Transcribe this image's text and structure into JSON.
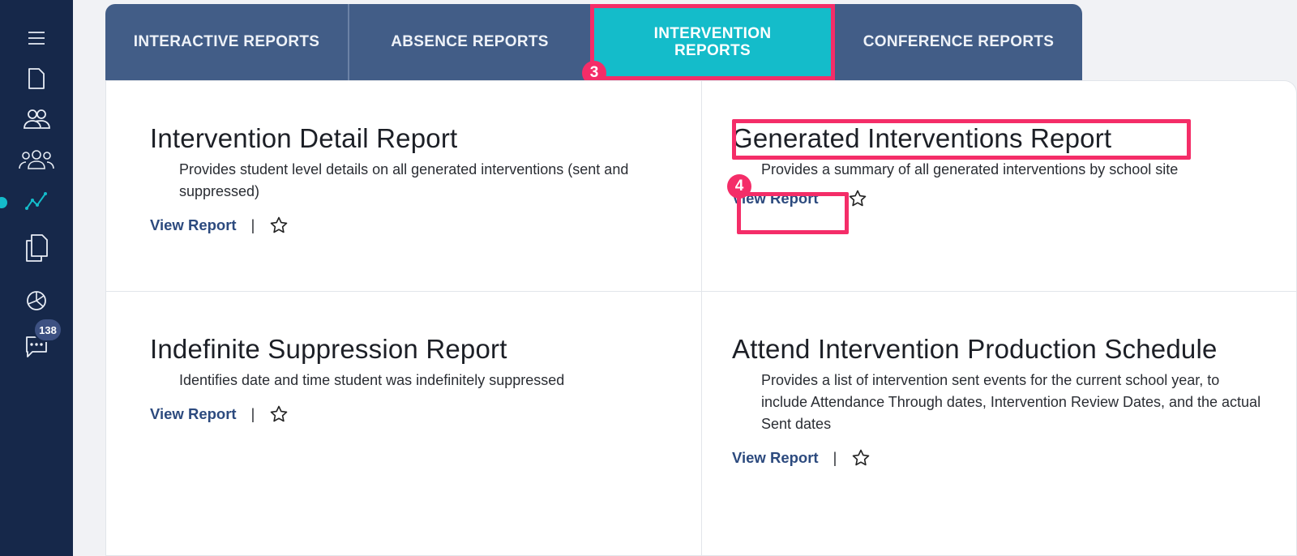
{
  "sidebar": {
    "icons": [
      "menu-icon",
      "document-icon",
      "users-icon",
      "group-icon",
      "analytics-icon",
      "copy-icon",
      "pie-chart-icon",
      "chat-icon"
    ],
    "chat_badge": "138"
  },
  "tabs": [
    {
      "label": "INTERACTIVE REPORTS"
    },
    {
      "label": "ABSENCE REPORTS"
    },
    {
      "label": "INTERVENTION REPORTS"
    },
    {
      "label": "CONFERENCE REPORTS"
    }
  ],
  "cards": [
    {
      "title": "Intervention Detail Report",
      "description": "Provides student level details on all generated interventions (sent and suppressed)",
      "link": "View Report",
      "separator": "|"
    },
    {
      "title": "Generated Interventions Report",
      "description": "Provides a summary of all generated interventions by school site",
      "link": "View Report"
    },
    {
      "title": "Indefinite Suppression Report",
      "description": "Identifies date and time student was indefinitely suppressed",
      "link": "View Report",
      "separator": "|"
    },
    {
      "title": "Attend Intervention Production Schedule",
      "description": "Provides a list of intervention sent events for the current school year, to include Attendance Through dates, Intervention Review Dates, and the actual Sent dates",
      "link": "View Report",
      "separator": "|"
    }
  ],
  "annotations": {
    "step3": "3",
    "step4": "4"
  },
  "colors": {
    "sidebar": "#16284a",
    "tab_bar": "#425d87",
    "active_tab": "#14bcca",
    "highlight": "#f42d68",
    "link": "#2c4a7e"
  }
}
